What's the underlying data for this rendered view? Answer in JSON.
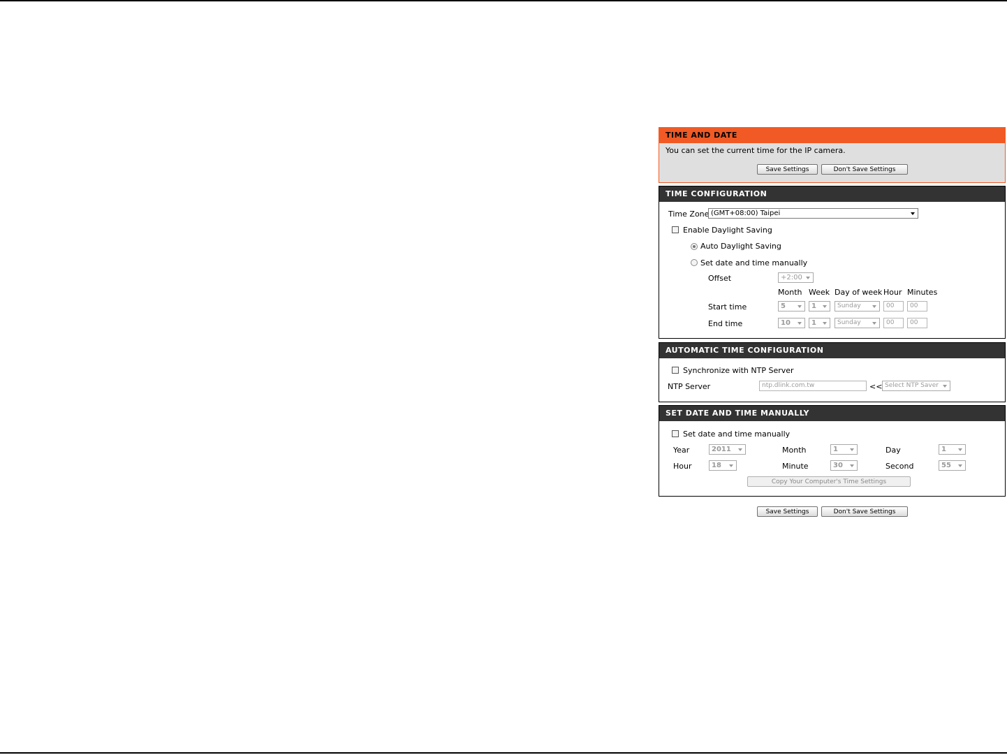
{
  "time_and_date": {
    "title": "TIME AND DATE",
    "description": "You can set the current time for the IP camera.",
    "save_label": "Save Settings",
    "dont_save_label": "Don't Save Settings"
  },
  "time_configuration": {
    "title": "TIME CONFIGURATION",
    "time_zone_label": "Time Zone",
    "time_zone_value": "(GMT+08:00) Taipei",
    "enable_dst_label": "Enable Daylight Saving",
    "auto_dst_label": "Auto Daylight Saving",
    "manual_dst_label": "Set date and time manually",
    "offset_label": "Offset",
    "offset_value": "+2:00",
    "col_month": "Month",
    "col_week": "Week",
    "col_day_of_week": "Day of week",
    "col_hour": "Hour",
    "col_minutes": "Minutes",
    "start_time_label": "Start time",
    "start": {
      "month": "5",
      "week": "1",
      "day": "Sunday",
      "hour": "00",
      "minutes": "00"
    },
    "end_time_label": "End time",
    "end": {
      "month": "10",
      "week": "1",
      "day": "Sunday",
      "hour": "00",
      "minutes": "00"
    }
  },
  "automatic_time": {
    "title": "AUTOMATIC TIME CONFIGURATION",
    "sync_label": "Synchronize with NTP Server",
    "ntp_label": "NTP Server",
    "ntp_value": "ntp.dlink.com.tw",
    "arrow": "<<",
    "ntp_select": "Select NTP Saver"
  },
  "manual_time": {
    "title": "SET DATE AND TIME MANUALLY",
    "set_manual_label": "Set date and time manually",
    "year_label": "Year",
    "year_value": "2011",
    "month_label": "Month",
    "month_value": "1",
    "day_label": "Day",
    "day_value": "1",
    "hour_label": "Hour",
    "hour_value": "18",
    "minute_label": "Minute",
    "minute_value": "30",
    "second_label": "Second",
    "second_value": "55",
    "copy_label": "Copy Your Computer's Time Settings"
  },
  "footer": {
    "save_label": "Save Settings",
    "dont_save_label": "Don't Save Settings"
  },
  "colors": {
    "accent": "#f15a24",
    "header_dark": "#333333",
    "panel_grey": "#dfdfdf"
  }
}
